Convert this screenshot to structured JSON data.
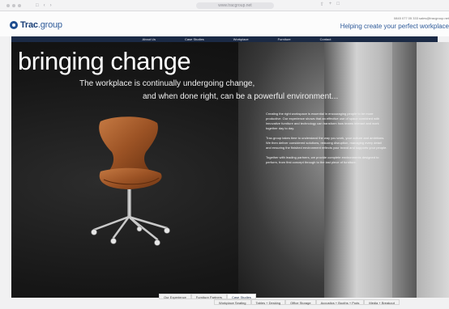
{
  "browser": {
    "url": "www.tracgroup.net"
  },
  "header": {
    "logo_bold": "Trac",
    "logo_light": ".group",
    "contact": "0845 077 05 333   sales@tracgroup.net",
    "tagline": "Helping create your perfect workplace"
  },
  "nav": {
    "items": [
      "About Us",
      "Case Studies",
      "Workplace",
      "Furniture",
      "Contact"
    ]
  },
  "hero": {
    "title": "bringing change",
    "subtitle_line1": "The workplace is continually undergoing change,",
    "subtitle_line2": "and when done right, can be a powerful environment..."
  },
  "body": {
    "paragraphs": [
      "Creating the right workspace is essential in encouraging people to be more productive. Our experience shows that an effective use of space combined with innovative furniture and technology can transform how teams interact and work together day to day.",
      "Trac.group takes time to understand the way you work, your culture and ambitions. We then deliver considered solutions, reducing disruption, managing every detail and ensuring the finished environment reflects your brand and supports your people.",
      "Together with leading partners, we provide complete environments designed to perform, from first concept through to the last piece of furniture."
    ]
  },
  "tabs": {
    "row1": [
      "Our Experience",
      "Furniture Partners",
      "Case Studies"
    ],
    "row2": [
      "Workplace Seating",
      "Tables + Desking",
      "Office Storage",
      "Acoustics + Booths + Pods",
      "Media + Breakout"
    ],
    "active_row1": "Case Studies"
  }
}
